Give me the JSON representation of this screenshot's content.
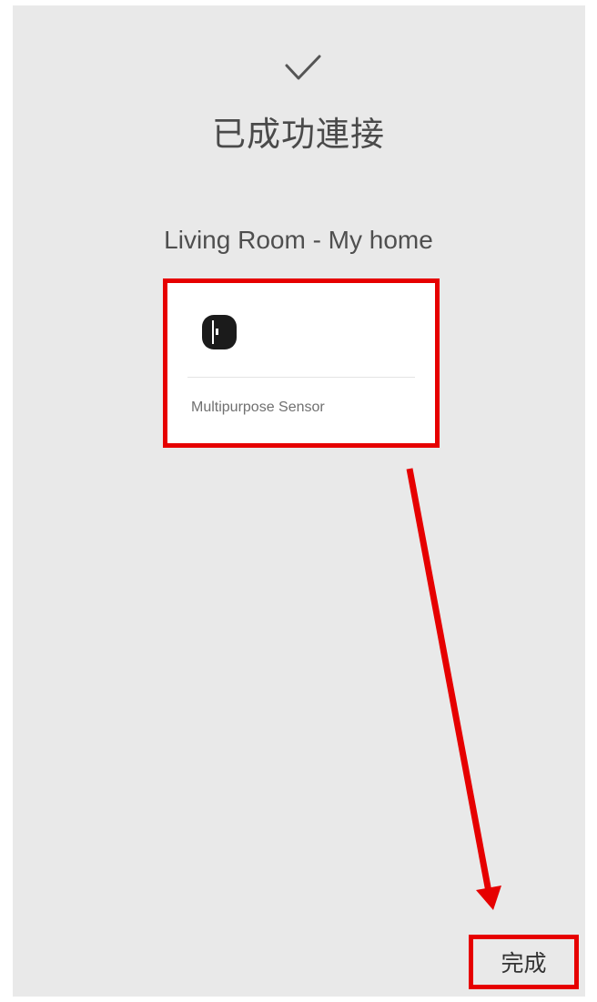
{
  "status": {
    "icon": "checkmark-icon",
    "title": "已成功連接"
  },
  "location": {
    "text": "Living Room - My home"
  },
  "device": {
    "icon": "multipurpose-sensor-icon",
    "name": "Multipurpose Sensor"
  },
  "footer": {
    "done_label": "完成"
  },
  "colors": {
    "background": "#e9e9e9",
    "card": "#ffffff",
    "highlight": "#e60000",
    "text": "#4a4a4a"
  }
}
